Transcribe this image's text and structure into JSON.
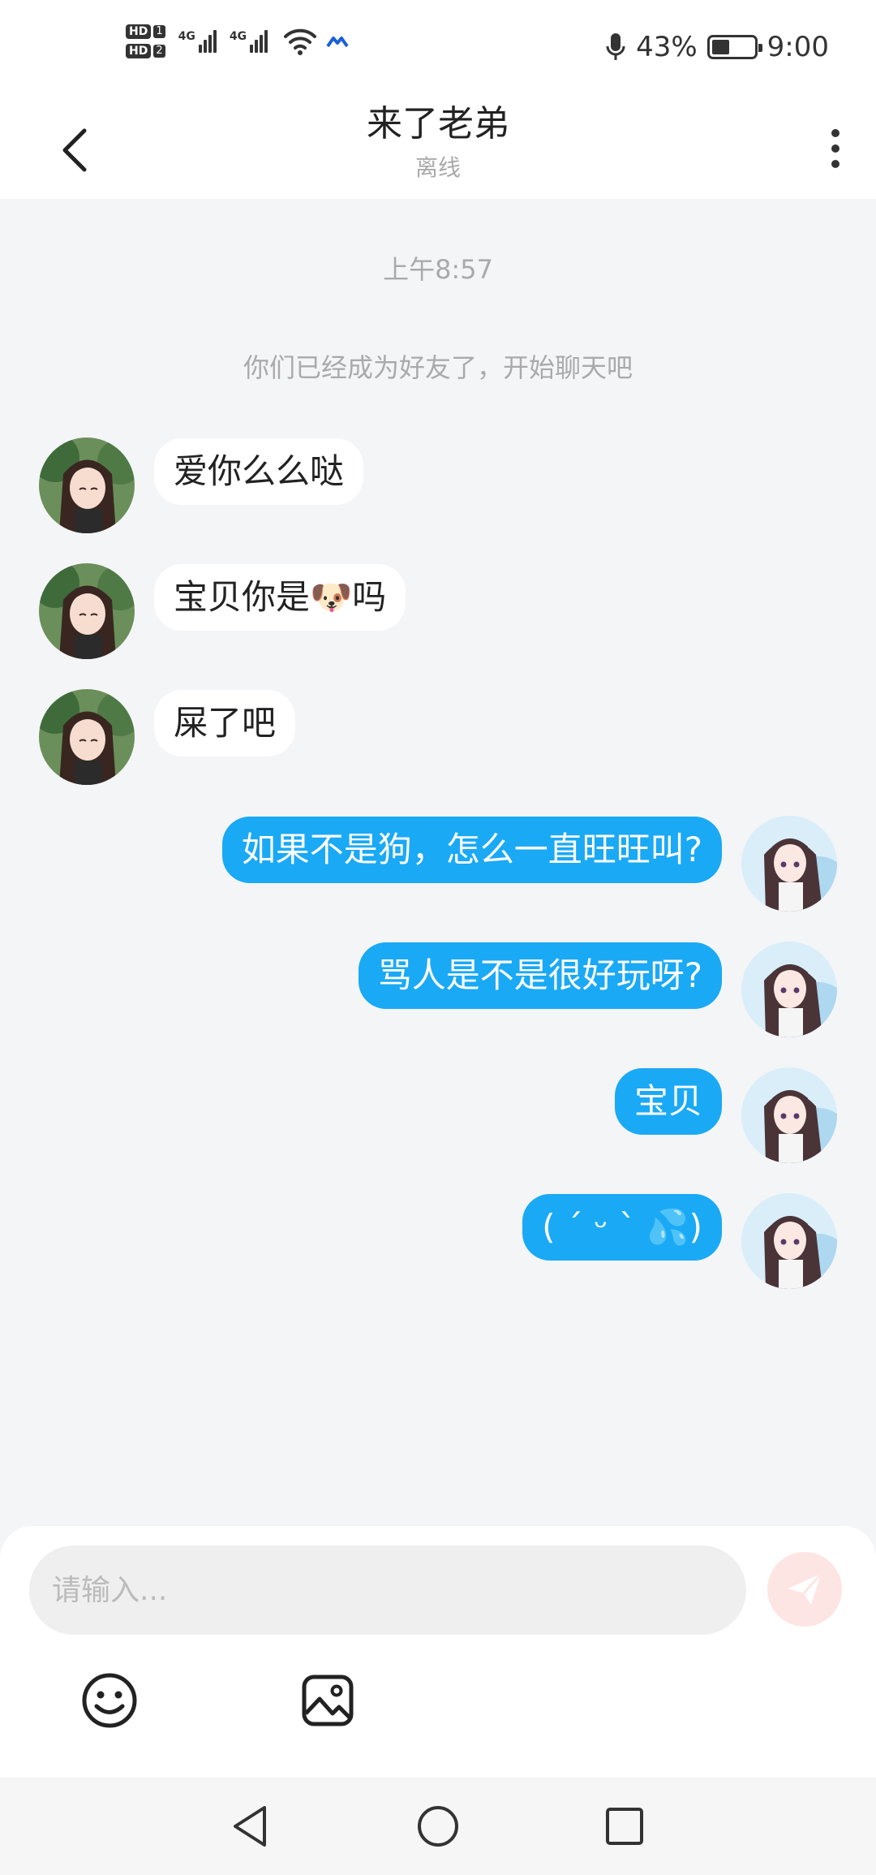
{
  "status_bar": {
    "hd1": "HD",
    "hd1_num": "1",
    "hd2": "HD",
    "hd2_num": "2",
    "net1": "4G",
    "net2": "4G",
    "battery_percent": "43%",
    "time": "9:00",
    "icons": [
      "sim1-hd-icon",
      "sim2-hd-icon",
      "signal-icon",
      "wifi-icon",
      "data-arrow-icon",
      "microphone-icon",
      "battery-icon"
    ]
  },
  "header": {
    "title": "来了老弟",
    "subtitle": "离线",
    "back_icon": "chevron-left-icon",
    "more_icon": "more-vertical-icon"
  },
  "chat": {
    "time_label": "上午8:57",
    "system_message": "你们已经成为好友了，开始聊天吧",
    "messages": [
      {
        "side": "left",
        "text": "爱你么么哒"
      },
      {
        "side": "left",
        "text": "宝贝你是🐶吗"
      },
      {
        "side": "left",
        "text": "屎了吧"
      },
      {
        "side": "right",
        "text": "如果不是狗，怎么一直旺旺叫?"
      },
      {
        "side": "right",
        "text": "骂人是不是很好玩呀?"
      },
      {
        "side": "right",
        "text": "宝贝"
      },
      {
        "side": "right",
        "text": "( ´ ᵕ ` 💦)"
      }
    ]
  },
  "input": {
    "placeholder": "请输入...",
    "value": "",
    "send_icon": "send-icon",
    "emoji_icon": "emoji-icon",
    "image_icon": "image-icon"
  },
  "navbar": {
    "back_icon": "nav-back-icon",
    "home_icon": "nav-home-icon",
    "recents_icon": "nav-recents-icon"
  },
  "colors": {
    "accent": "#1aa9f5",
    "background": "#f4f5f7",
    "send_button": "#fde5e4",
    "send_arrow": "#ffffff"
  }
}
